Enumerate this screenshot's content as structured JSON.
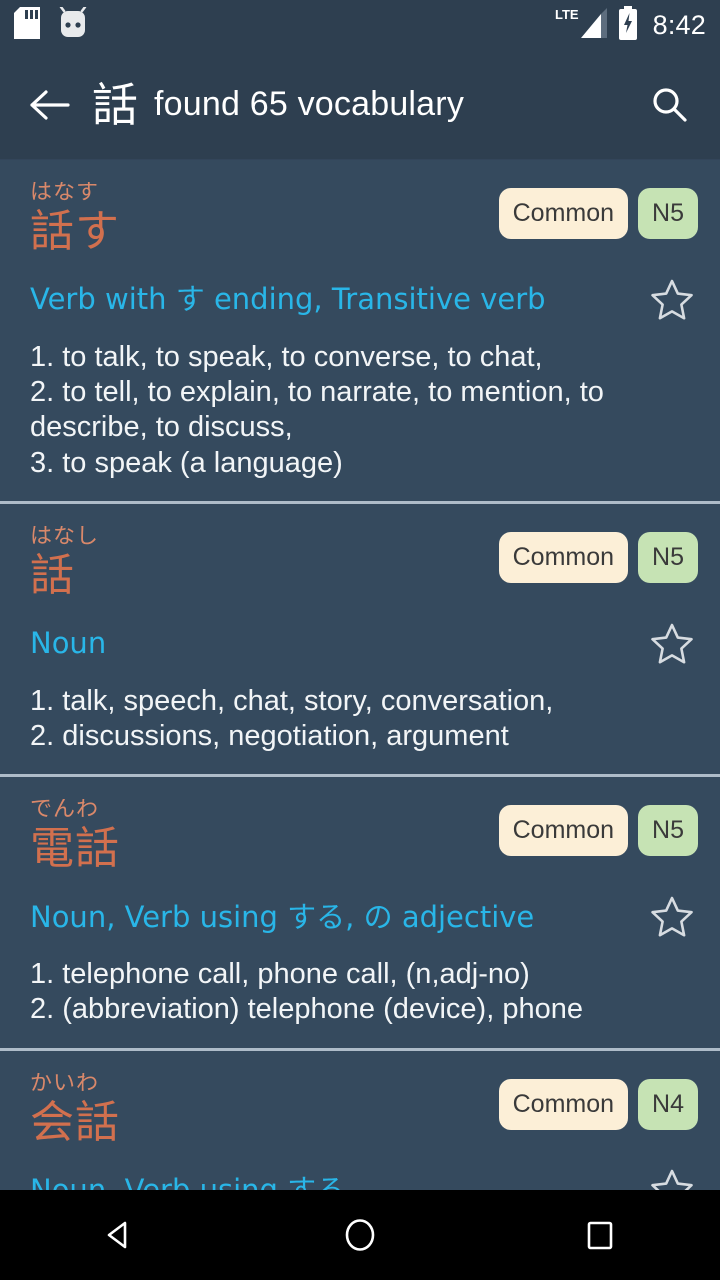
{
  "status_bar": {
    "icons": [
      "sd-card-icon",
      "android-head-icon"
    ],
    "network_label": "LTE",
    "battery_state": "charging",
    "time": "8:42"
  },
  "toolbar": {
    "back_icon": "arrow-left-icon",
    "kanji": "話",
    "title": "found 65 vocabulary",
    "search_icon": "search-icon"
  },
  "colors": {
    "background": "#354a5e",
    "toolbar": "#2e3f50",
    "kanji": "#d2704e",
    "furigana": "#d9886a",
    "part_of_speech": "#29b6e8",
    "definition": "#f2f5f7",
    "badge_common_bg": "#fcefd7",
    "badge_level_bg": "#c6e3b4",
    "divider": "#aebcc9",
    "navbar": "#000000"
  },
  "entries": [
    {
      "furigana": "はなす",
      "kanji": "話す",
      "common_label": "Common",
      "level_label": "N5",
      "part_of_speech": "Verb with す ending, Transitive verb",
      "favorite": false,
      "senses": [
        "1. to talk, to speak, to converse, to chat,",
        "2. to tell, to explain, to narrate, to mention, to describe, to discuss,",
        "3. to speak (a language)"
      ]
    },
    {
      "furigana": "はなし",
      "kanji": "話",
      "common_label": "Common",
      "level_label": "N5",
      "part_of_speech": "Noun",
      "favorite": false,
      "senses": [
        "1. talk, speech, chat, story, conversation,",
        "2. discussions, negotiation, argument"
      ]
    },
    {
      "furigana": "でんわ",
      "kanji": "電話",
      "common_label": "Common",
      "level_label": "N5",
      "part_of_speech": "Noun, Verb using する, の adjective",
      "favorite": false,
      "senses": [
        "1. telephone call, phone call, (n,adj-no)",
        "2. (abbreviation) telephone (device), phone"
      ]
    },
    {
      "furigana": "かいわ",
      "kanji": "会話",
      "common_label": "Common",
      "level_label": "N4",
      "part_of_speech": "Noun, Verb using する",
      "favorite": false,
      "senses": []
    }
  ],
  "nav_bar": {
    "back_label": "back-triangle-icon",
    "home_label": "home-circle-icon",
    "recents_label": "recents-square-icon"
  }
}
